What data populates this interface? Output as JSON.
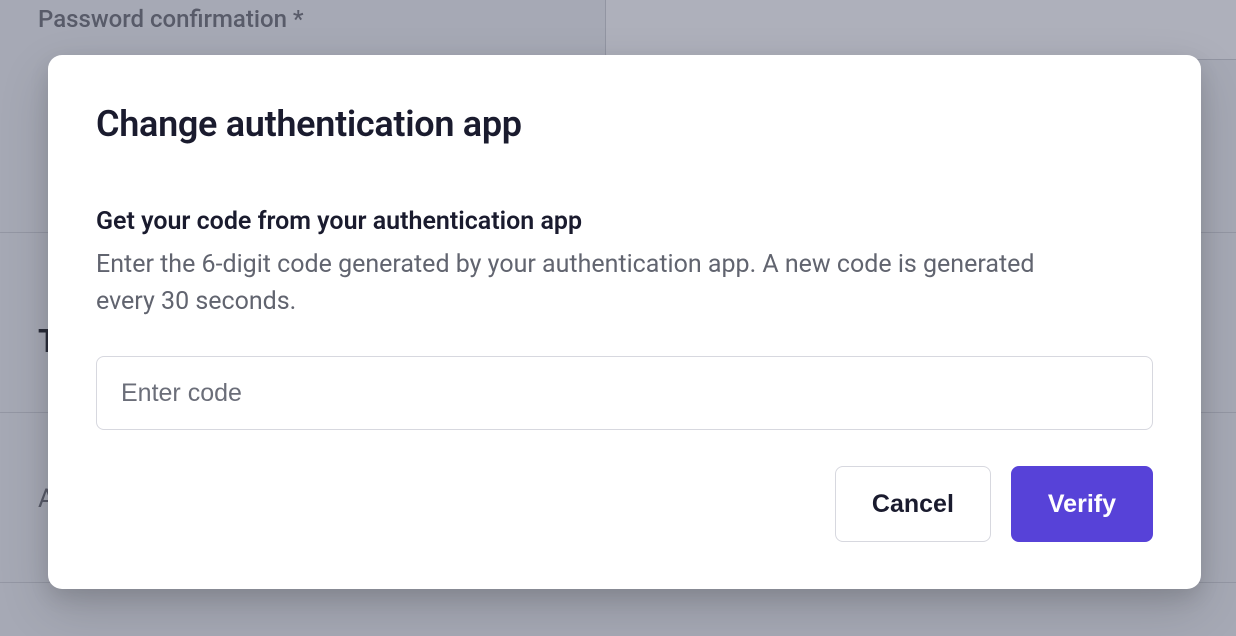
{
  "background": {
    "password_confirmation_label": "Password confirmation *",
    "letter_t": "T",
    "letter_a": "A"
  },
  "modal": {
    "title": "Change authentication app",
    "subtitle": "Get your code from your authentication app",
    "description": "Enter the 6-digit code generated by your authentication app. A new code is generated every 30 seconds.",
    "code_input": {
      "placeholder": "Enter code",
      "value": ""
    },
    "buttons": {
      "cancel": "Cancel",
      "verify": "Verify"
    }
  }
}
